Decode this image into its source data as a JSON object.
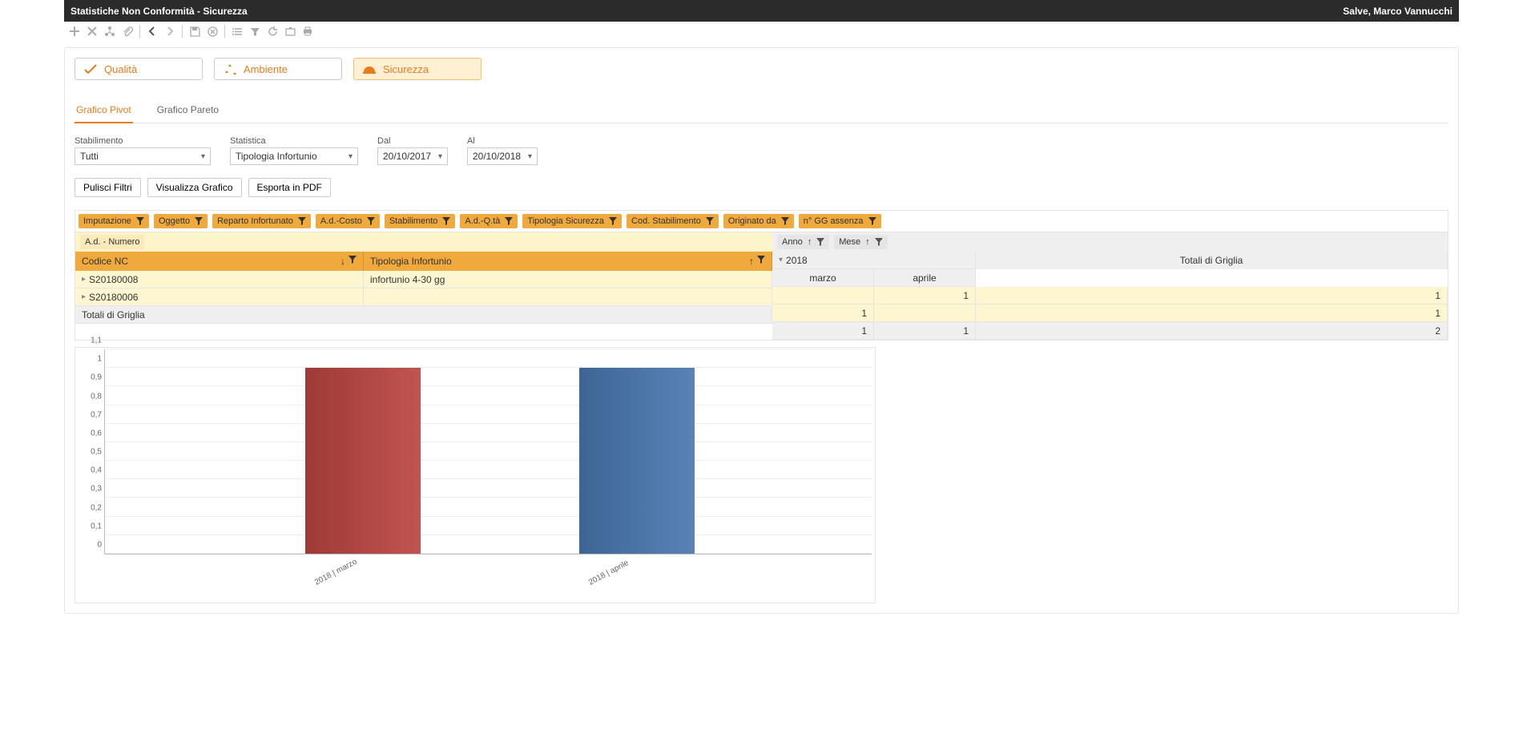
{
  "header": {
    "title": "Statistiche Non Conformità - Sicurezza",
    "user": "Salve, Marco Vannucchi"
  },
  "category_tabs": {
    "qualita": "Qualità",
    "ambiente": "Ambiente",
    "sicurezza": "Sicurezza"
  },
  "subtabs": {
    "pivot": "Grafico Pivot",
    "pareto": "Grafico Pareto"
  },
  "filters": {
    "stabilimento_label": "Stabilimento",
    "stabilimento_value": "Tutti",
    "statistica_label": "Statistica",
    "statistica_value": "Tipologia Infortunio",
    "dal_label": "Dal",
    "dal_value": "20/10/2017",
    "al_label": "Al",
    "al_value": "20/10/2018"
  },
  "actions": {
    "pulisci": "Pulisci Filtri",
    "visualizza": "Visualizza Grafico",
    "esporta": "Esporta in PDF"
  },
  "pivot": {
    "filter_chips": [
      "Imputazione",
      "Oggetto",
      "Reparto Infortunato",
      "A.d.-Costo",
      "Stabilimento",
      "A.d.-Q.tà",
      "Tipologia Sicurezza",
      "Cod. Stabilimento",
      "Originato da",
      "n° GG assenza"
    ],
    "data_area": "A.d. - Numero",
    "col_chips": {
      "anno": "Anno",
      "mese": "Mese"
    },
    "row_headers": {
      "codice": "Codice NC",
      "tipologia": "Tipologia Infortunio"
    },
    "year": "2018",
    "months": [
      "marzo",
      "aprile"
    ],
    "totals_label": "Totali di Griglia",
    "rows": [
      {
        "codice": "S20180008",
        "tipologia": "infortunio 4-30 gg",
        "marzo": "",
        "aprile": "1",
        "totale": "1"
      },
      {
        "codice": "S20180006",
        "tipologia": "",
        "marzo": "1",
        "aprile": "",
        "totale": "1"
      }
    ],
    "totals": {
      "marzo": "1",
      "aprile": "1",
      "totale": "2"
    }
  },
  "chart_data": {
    "type": "bar",
    "categories": [
      "2018 | marzo",
      "2018 | aprile"
    ],
    "values": [
      1,
      1
    ],
    "ylim": [
      0,
      1.1
    ],
    "yticks": [
      "0",
      "0,1",
      "0,2",
      "0,3",
      "0,4",
      "0,5",
      "0,6",
      "0,7",
      "0,8",
      "0,9",
      "1",
      "1,1"
    ],
    "colors": [
      "#b84b47",
      "#4f78a8"
    ]
  }
}
